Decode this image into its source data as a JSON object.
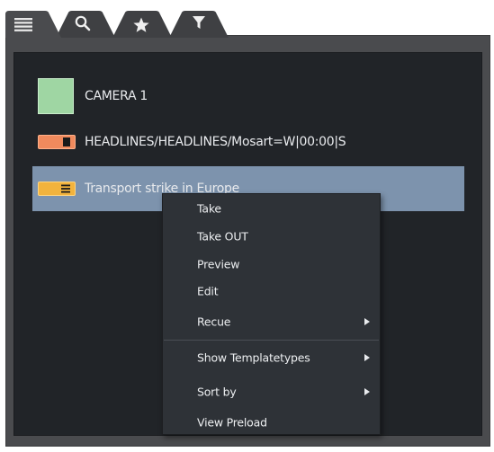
{
  "tabs": [
    {
      "icon": "list-icon",
      "active": true
    },
    {
      "icon": "search-icon",
      "active": false
    },
    {
      "icon": "star-icon",
      "active": false
    },
    {
      "icon": "filter-icon",
      "active": false
    }
  ],
  "items": [
    {
      "label": "CAMERA 1",
      "icon": "camera-swatch-icon",
      "color": "#9fd6a3"
    },
    {
      "label": "HEADLINES/HEADLINES/Mosart=W|00:00|S",
      "icon": "headlines-clip-icon",
      "color": "#f08a5d"
    },
    {
      "label": "Transport strike in Europe",
      "icon": "story-template-icon",
      "color": "#f2b33d",
      "selected": true
    }
  ],
  "context_menu": {
    "take": "Take",
    "take_out": "Take OUT",
    "preview": "Preview",
    "edit": "Edit",
    "recue": "Recue",
    "show_templatetypes": "Show Templatetypes",
    "sort_by": "Sort by",
    "view_preload": "View Preload"
  },
  "colors": {
    "panel_bg": "#212428",
    "selection": "#7d93ad",
    "menu_bg": "#2e3237",
    "frame_bg": "#4a4b4e"
  }
}
